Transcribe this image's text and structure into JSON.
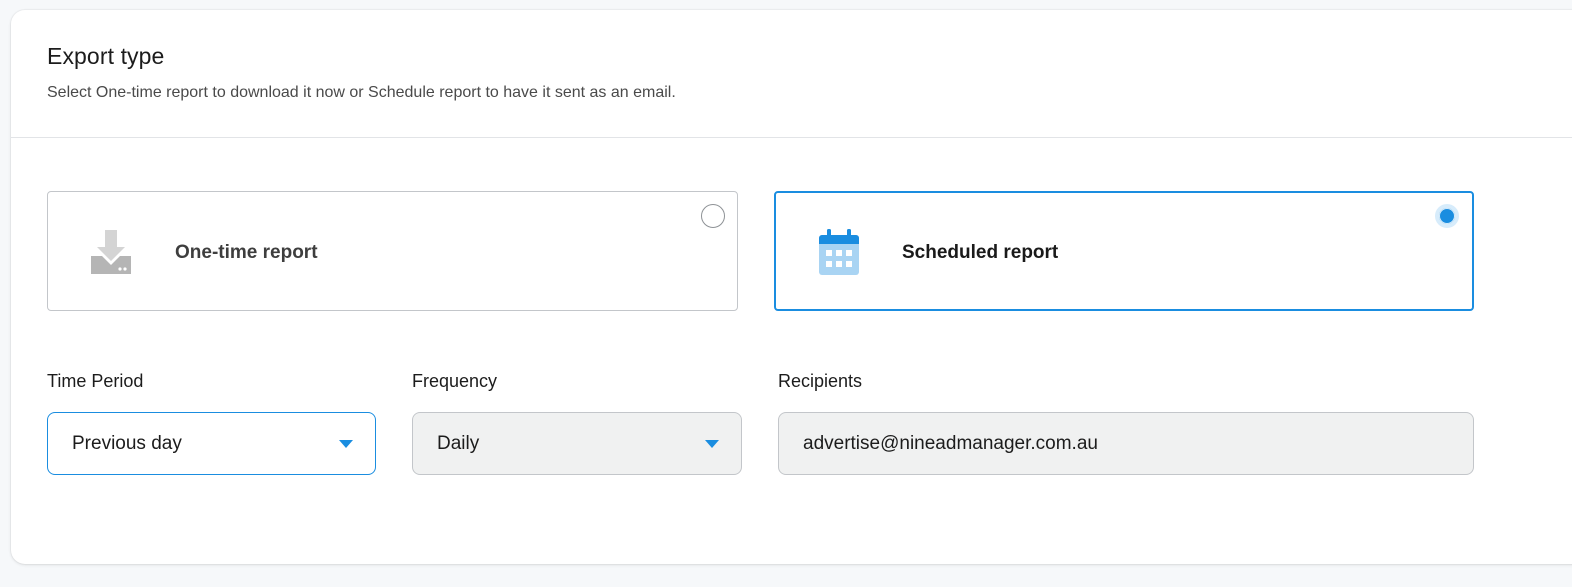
{
  "header": {
    "title": "Export type",
    "subtitle": "Select One-time report to download it now or Schedule report to have it sent as an email."
  },
  "options": [
    {
      "label": "One-time report",
      "icon": "download-tray-icon",
      "selected": false
    },
    {
      "label": "Scheduled report",
      "icon": "calendar-icon",
      "selected": true
    }
  ],
  "fields": {
    "time_period": {
      "label": "Time Period",
      "value": "Previous day"
    },
    "frequency": {
      "label": "Frequency",
      "value": "Daily"
    },
    "recipients": {
      "label": "Recipients",
      "value": "advertise@nineadmanager.com.au"
    }
  },
  "colors": {
    "accent": "#1a8de0",
    "calendar_light": "#a9d4f3",
    "download_icon": "#b8b8b8"
  }
}
